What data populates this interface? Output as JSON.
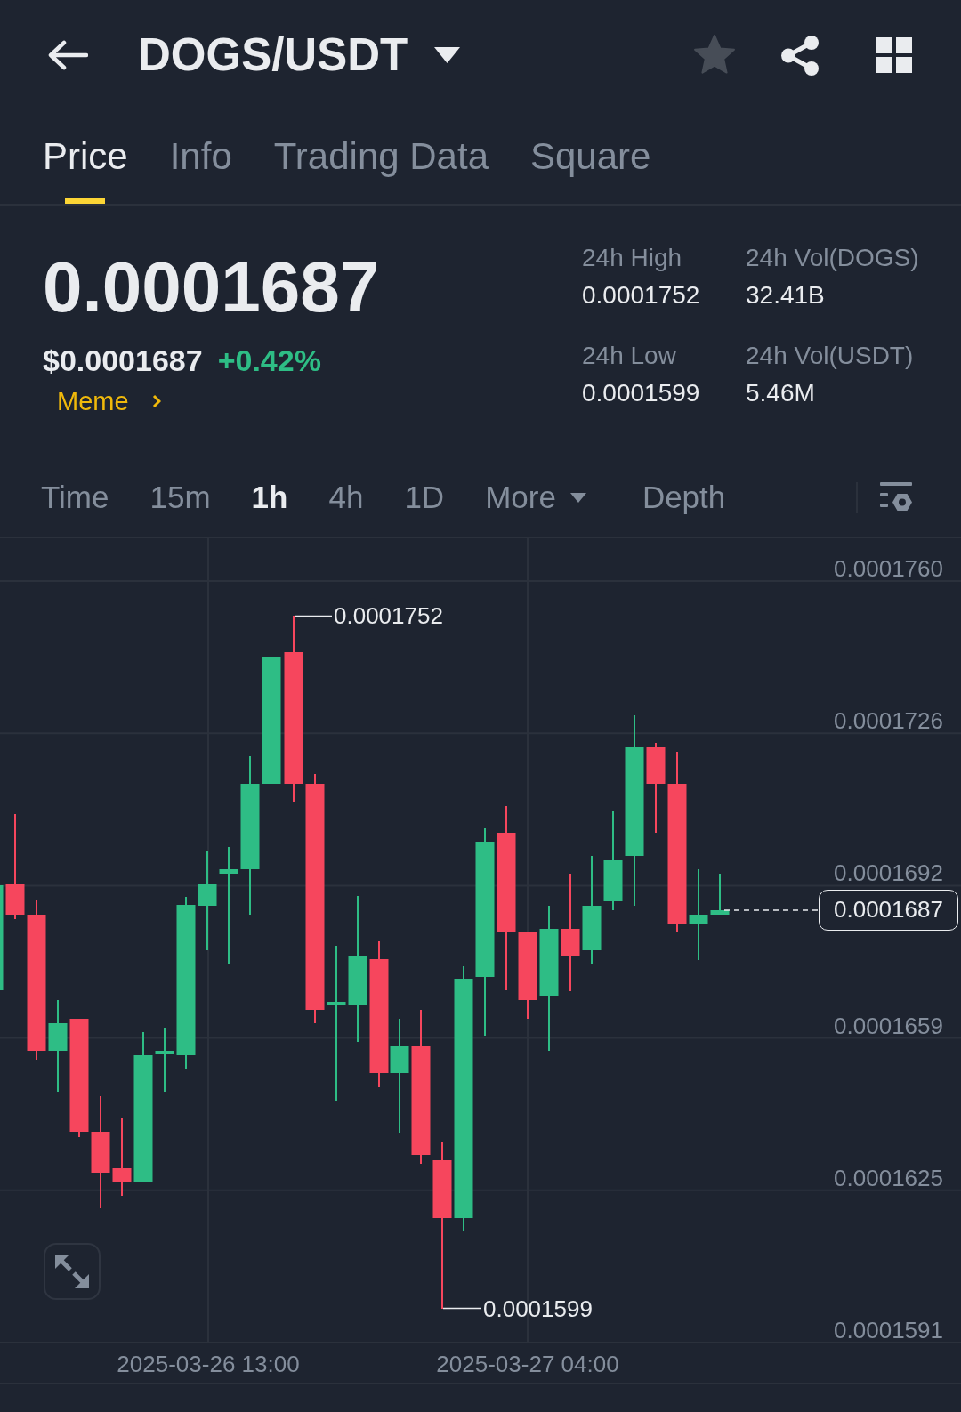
{
  "header": {
    "title": "DOGS/USDT",
    "favorite": false
  },
  "tabs": [
    {
      "label": "Price",
      "selected": true
    },
    {
      "label": "Info",
      "selected": false
    },
    {
      "label": "Trading Data",
      "selected": false
    },
    {
      "label": "Square",
      "selected": false
    }
  ],
  "ticker": {
    "last_price": "0.0001687",
    "usd_price": "$0.0001687",
    "change": "+0.42%",
    "tag": "Meme"
  },
  "stats": [
    {
      "label": "24h High",
      "value": "0.0001752"
    },
    {
      "label": "24h Vol(DOGS)",
      "value": "32.41B"
    },
    {
      "label": "24h Low",
      "value": "0.0001599"
    },
    {
      "label": "24h Vol(USDT)",
      "value": "5.46M"
    }
  ],
  "intervals": [
    {
      "label": "Time",
      "kind": "option",
      "selected": false
    },
    {
      "label": "15m",
      "kind": "option",
      "selected": false
    },
    {
      "label": "1h",
      "kind": "option",
      "selected": true
    },
    {
      "label": "4h",
      "kind": "option",
      "selected": false
    },
    {
      "label": "1D",
      "kind": "option",
      "selected": false
    },
    {
      "label": "More",
      "kind": "dropdown",
      "selected": false
    },
    {
      "label": "Depth",
      "kind": "option",
      "selected": false
    }
  ],
  "chart": {
    "price_ticks": [
      "0.0001760",
      "0.0001726",
      "0.0001692",
      "0.0001659",
      "0.0001625",
      "0.0001591"
    ],
    "time_ticks": [
      "2025-03-26 13:00",
      "2025-03-27 04:00"
    ],
    "high_marker": "0.0001752",
    "low_marker": "0.0001599",
    "last_price_tag": "0.0001687"
  }
}
